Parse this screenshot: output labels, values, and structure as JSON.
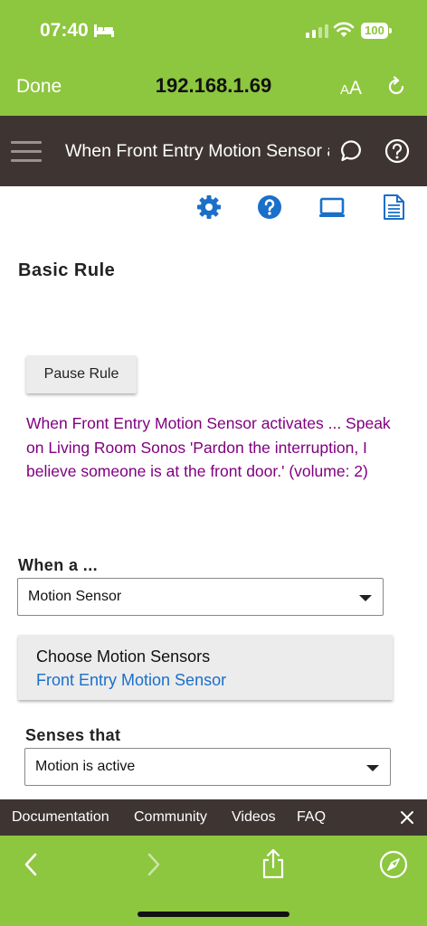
{
  "status_bar": {
    "time": "07:40",
    "battery": "100"
  },
  "browser": {
    "done_label": "Done",
    "url": "192.168.1.69",
    "aa_small": "A",
    "aa_large": "A"
  },
  "app_header": {
    "title": "When Front Entry Motion Sensor activates"
  },
  "page": {
    "section_title": "Basic Rule",
    "pause_label": "Pause Rule",
    "rule_description": "When Front Entry Motion Sensor activates ... Speak on Living Room Sonos 'Pardon the interruption, I believe someone is at the front door.' (volume: 2)"
  },
  "trigger": {
    "label": "When a ...",
    "selected": "Motion Sensor",
    "chooser_title": "Choose Motion Sensors",
    "chooser_value": "Front Entry Motion Sensor",
    "senses_label": "Senses that",
    "senses_selected": "Motion is active"
  },
  "footer_links": {
    "documentation": "Documentation",
    "community": "Community",
    "videos": "Videos",
    "faq": "FAQ"
  },
  "colors": {
    "safari_green": "#8dc63f",
    "header_dark": "#3e3533",
    "icon_blue": "#1a6fc9",
    "rule_purple": "#800080"
  }
}
